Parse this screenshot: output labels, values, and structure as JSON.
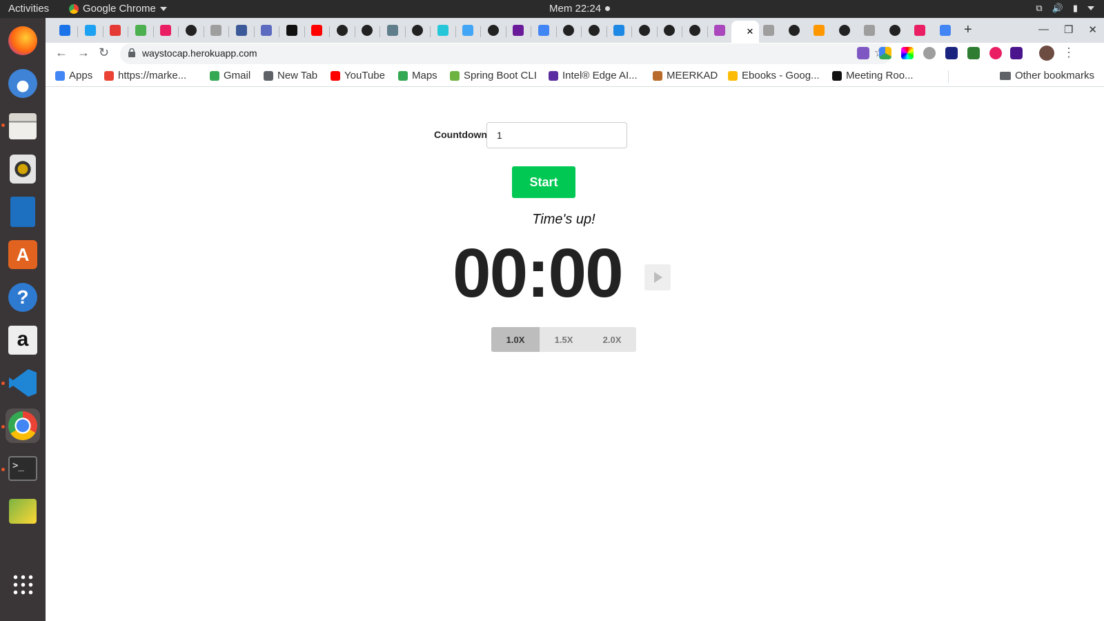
{
  "topbar": {
    "activities": "Activities",
    "app_name": "Google Chrome",
    "clock": "Mem 22:24"
  },
  "browser": {
    "url": "waystocap.herokuapp.com",
    "bookmarks": [
      {
        "label": "Apps",
        "color": "#4285f4"
      },
      {
        "label": "https://marke...",
        "color": "#ea4335"
      },
      {
        "label": "Gmail",
        "color": "#34a853"
      },
      {
        "label": "New Tab",
        "color": "#5f6368"
      },
      {
        "label": "YouTube",
        "color": "#ff0000"
      },
      {
        "label": "Maps",
        "color": "#34a853"
      },
      {
        "label": "Spring Boot CLI",
        "color": "#6db33f"
      },
      {
        "label": "Intel® Edge AI...",
        "color": "#5b2da0"
      },
      {
        "label": "MEERKAD",
        "color": "#b86b2a"
      },
      {
        "label": "Ebooks - Goog...",
        "color": "#fbbc05"
      },
      {
        "label": "Meeting Roo...",
        "color": "#111111"
      }
    ],
    "other_bookmarks": "Other bookmarks"
  },
  "page": {
    "countdown_label": "Countdown:",
    "countdown_value": "1",
    "start_label": "Start",
    "status": "Time's up!",
    "timer": "00:00",
    "speeds": [
      "1.0X",
      "1.5X",
      "2.0X"
    ],
    "selected_speed": "1.0X"
  }
}
